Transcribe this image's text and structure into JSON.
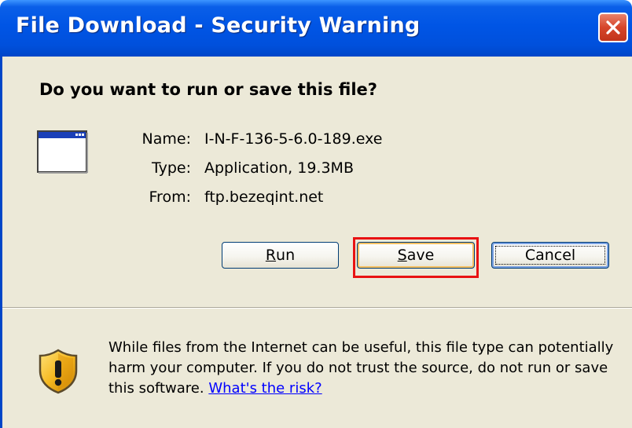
{
  "window": {
    "title": "File Download - Security Warning"
  },
  "dialog": {
    "question": "Do you want to run or save this file?",
    "file": {
      "icon": "application-window-icon",
      "name_label": "Name:",
      "name_value": "I-N-F-136-5-6.0-189.exe",
      "type_label": "Type:",
      "type_value": "Application, 19.3MB",
      "from_label": "From:",
      "from_value": "ftp.bezeqint.net"
    },
    "buttons": {
      "run": {
        "mnemonic": "R",
        "rest": "un"
      },
      "save": {
        "mnemonic": "S",
        "rest": "ave"
      },
      "cancel": {
        "label": "Cancel"
      }
    },
    "warning": {
      "icon": "security-shield-icon",
      "text": "While files from the Internet can be useful, this file type can potentially harm your computer. If you do not trust the source, do not run or save this software.",
      "link": "What's the risk?"
    }
  },
  "colors": {
    "titlebar": "#0055e5",
    "dialog_bg": "#ece9d8",
    "highlight_outline": "#e81212",
    "link": "#0000ff"
  }
}
